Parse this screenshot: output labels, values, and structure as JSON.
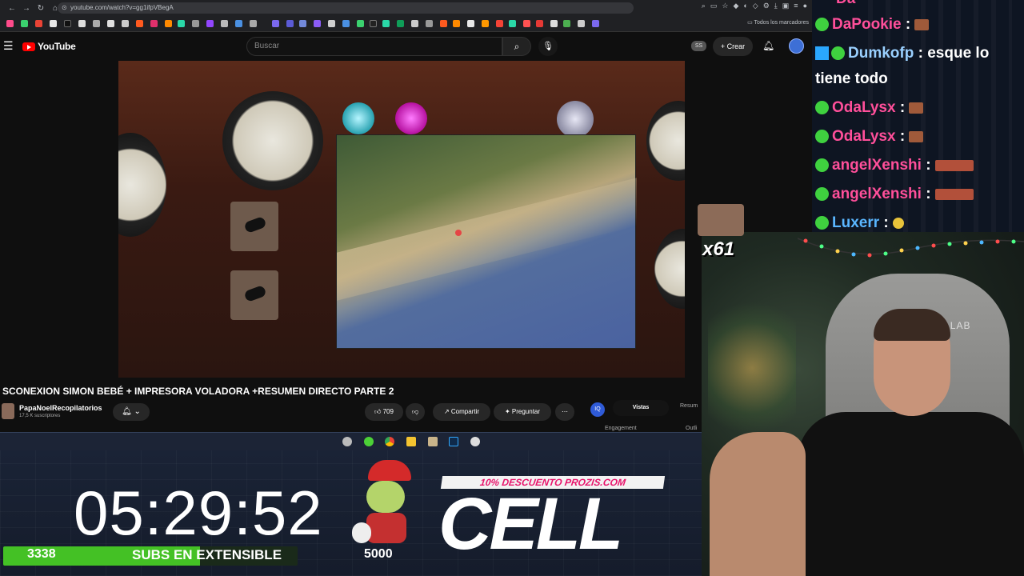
{
  "browser": {
    "url": "youtube.com/watch?v=gg1ifpVBegA",
    "all_bookmarks": "Todos los marcadores"
  },
  "youtube": {
    "logo_text": "YouTube",
    "search_placeholder": "Buscar",
    "ss_badge": "SS",
    "create_label": "Crear",
    "video_title": "SCONEXION SIMON BEBÉ + IMPRESORA VOLADORA +RESUMEN DIRECTO PARTE 2",
    "channel_name": "PapaNoelRecopilatorios",
    "channel_subs": "17,5 K suscriptores",
    "likes": "709",
    "share_label": "Compartir",
    "ask_label": "Preguntar",
    "panel_tab_active": "Vistas",
    "panel_tab_next": "Resum",
    "engagement_label": "Engagement",
    "outline_label": "Outli"
  },
  "chat": {
    "messages": [
      {
        "user": "DaPookie",
        "color": "#ff4f9a",
        "text": ""
      },
      {
        "user": "Dumkofp",
        "color": "#9ad0ff",
        "text": "esque lo"
      },
      {
        "user": "",
        "color": "#ffffff",
        "text": "tiene todo"
      },
      {
        "user": "OdaLysx",
        "color": "#ff4f9a",
        "text": ""
      },
      {
        "user": "OdaLysx",
        "color": "#ff4f9a",
        "text": ""
      },
      {
        "user": "angelXenshi",
        "color": "#ff4f9a",
        "text": ""
      },
      {
        "user": "angelXenshi",
        "color": "#ff4f9a",
        "text": ""
      },
      {
        "user": "Luxerr",
        "color": "#5ab6ff",
        "text": ""
      }
    ]
  },
  "overlay": {
    "combo": "x61",
    "timer": "05:29:52",
    "sub_count": "3338",
    "sub_label": "SUBS EN EXTENSIBLE",
    "sub_target": "5000",
    "sub_progress": 0.6676,
    "promo": "10% DESCUENTO PROZIS.COM",
    "brand": "CELL",
    "cam_chair_text": "CRET LAB",
    "colors": {
      "progress": "#44c125",
      "promo": "#e8136b",
      "youtube_red": "#ff0000"
    }
  }
}
